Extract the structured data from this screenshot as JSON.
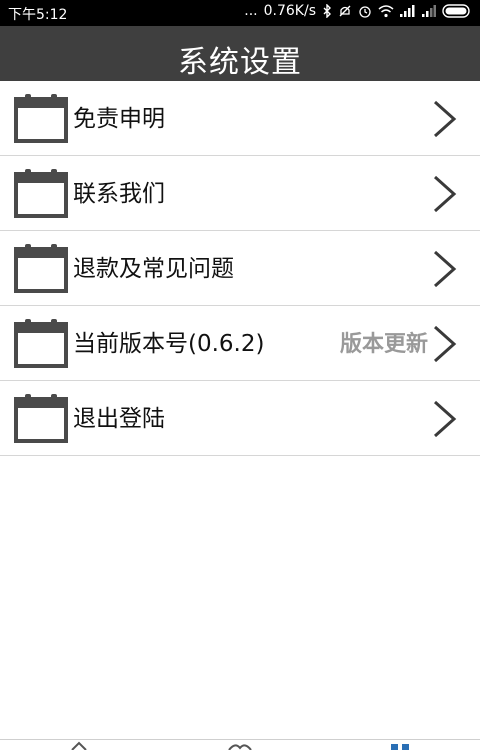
{
  "status_bar": {
    "time": "下午5:12",
    "dots": "...",
    "network_speed": "0.76K/s",
    "icons": [
      "bluetooth-icon",
      "mute-icon",
      "alarm-icon",
      "wifi-icon",
      "signal-icon",
      "signal-icon",
      "battery-icon"
    ]
  },
  "header": {
    "title": "系统设置"
  },
  "menu": {
    "items": [
      {
        "label": "免责申明",
        "extra": ""
      },
      {
        "label": "联系我们",
        "extra": ""
      },
      {
        "label": "退款及常见问题",
        "extra": ""
      },
      {
        "label": "当前版本号(0.6.2)",
        "extra": "版本更新"
      },
      {
        "label": "退出登陆",
        "extra": ""
      }
    ]
  },
  "colors": {
    "header_bg": "#3f3f3f",
    "icon_gray": "#4a4a4a",
    "extra_text": "#999999"
  }
}
